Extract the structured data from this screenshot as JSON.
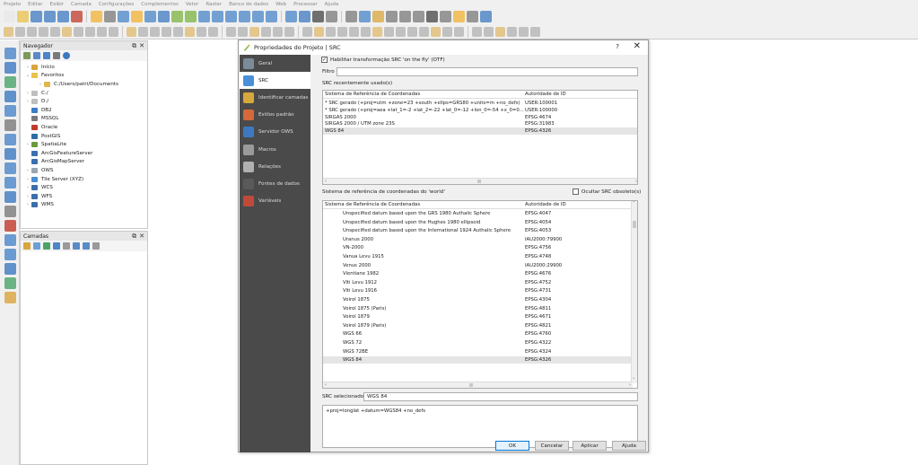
{
  "menubar": [
    "Projeto",
    "Editar",
    "Exibir",
    "Camada",
    "Configurações",
    "Complementos",
    "Vetor",
    "Raster",
    "Banco de dados",
    "Web",
    "Processar",
    "Ajuda"
  ],
  "navigator": {
    "title": "Navegador",
    "items": [
      {
        "label": "Início",
        "arrow": "›",
        "color": "#d9a53c",
        "indent": 0
      },
      {
        "label": "Favoritos",
        "arrow": "⌄",
        "color": "#e9c24a",
        "indent": 0
      },
      {
        "label": "C:/Users/patri/Documents",
        "arrow": "›",
        "color": "#e1b64c",
        "indent": 1
      },
      {
        "label": "C:/",
        "arrow": "›",
        "color": "#bfbfbf",
        "indent": 0
      },
      {
        "label": "D:/",
        "arrow": "›",
        "color": "#bfbfbf",
        "indent": 0
      },
      {
        "label": "DB2",
        "arrow": "",
        "color": "#3d7cc9",
        "indent": 0
      },
      {
        "label": "MSSQL",
        "arrow": "",
        "color": "#7a7a7a",
        "indent": 0
      },
      {
        "label": "Oracle",
        "arrow": "",
        "color": "#c0392b",
        "indent": 0
      },
      {
        "label": "PostGIS",
        "arrow": "",
        "color": "#2e6da4",
        "indent": 0
      },
      {
        "label": "SpatiaLite",
        "arrow": "›",
        "color": "#6b9b3c",
        "indent": 0
      },
      {
        "label": "ArcGisFeatureServer",
        "arrow": "",
        "color": "#3a6fb0",
        "indent": 0
      },
      {
        "label": "ArcGisMapServer",
        "arrow": "",
        "color": "#3a6fb0",
        "indent": 0
      },
      {
        "label": "OWS",
        "arrow": "›",
        "color": "#9aa6b2",
        "indent": 0
      },
      {
        "label": "Tile Server (XYZ)",
        "arrow": "›",
        "color": "#4a8fd3",
        "indent": 0
      },
      {
        "label": "WCS",
        "arrow": "›",
        "color": "#3b6fa8",
        "indent": 0
      },
      {
        "label": "WFS",
        "arrow": "›",
        "color": "#3b6fa8",
        "indent": 0
      },
      {
        "label": "WMS",
        "arrow": "›",
        "color": "#3b6fa8",
        "indent": 0
      }
    ]
  },
  "layers": {
    "title": "Camadas"
  },
  "dialog": {
    "title": "Propriedades do Projeto | SRC",
    "help": "?",
    "close": "✕",
    "sidebar": [
      {
        "label": "Geral",
        "color": "#7c8b9a"
      },
      {
        "label": "SRC",
        "color": "#4a90d9"
      },
      {
        "label": "Identificar camadas",
        "color": "#d6a83c"
      },
      {
        "label": "Estilos padrão",
        "color": "#d4693b"
      },
      {
        "label": "Servidor OWS",
        "color": "#3d79c0"
      },
      {
        "label": "Macros",
        "color": "#9a9a9a"
      },
      {
        "label": "Relações",
        "color": "#b0b0b0"
      },
      {
        "label": "Fontes de dados",
        "color": "#5a5a5a"
      },
      {
        "label": "Variáveis",
        "color": "#c04a3a"
      }
    ],
    "otf_label": "Habilitar transformação SRC 'on the fly' (OTF)",
    "otf_checked": "✓",
    "filter_label": "Filtro",
    "filter_value": "",
    "recent_label": "SRC recentemente usado(s)",
    "col_name": "Sistema de Referência de Coordenadas",
    "col_authority": "Autoridade de ID",
    "recent": [
      {
        "name": "* SRC gerado (+proj=utm +zone=23 +south +ellps=GRS80 +units=m +no_defs)",
        "id": "USER:100001"
      },
      {
        "name": "* SRC gerado (+proj=aea +lat_1=-2 +lat_2=-22 +lat_0=-12 +lon_0=-54 +x_0=0...",
        "id": "USER:100000"
      },
      {
        "name": "SIRGAS 2000",
        "id": "EPSG:4674"
      },
      {
        "name": "SIRGAS 2000 / UTM zone 23S",
        "id": "EPSG:31983"
      },
      {
        "name": "WGS 84",
        "id": "EPSG:4326"
      }
    ],
    "world_label": "Sistema de referência de coordenadas do 'world'",
    "hide_deprecated": "Ocultar SRC obsoleto(s)",
    "world": [
      {
        "name": "Unspecified datum based upon the GRS 1980 Authalic Sphere",
        "id": "EPSG:4047"
      },
      {
        "name": "Unspecified datum based upon the Hughes 1980 ellipsoid",
        "id": "EPSG:4054"
      },
      {
        "name": "Unspecified datum based upon the International 1924 Authalic Sphere",
        "id": "EPSG:4053"
      },
      {
        "name": "Uranus 2000",
        "id": "IAU2000:79900"
      },
      {
        "name": "VN-2000",
        "id": "EPSG:4756"
      },
      {
        "name": "Vanua Levu 1915",
        "id": "EPSG:4748"
      },
      {
        "name": "Venus 2000",
        "id": "IAU2000:29900"
      },
      {
        "name": "Vientiane 1982",
        "id": "EPSG:4676"
      },
      {
        "name": "Viti Levu 1912",
        "id": "EPSG:4752"
      },
      {
        "name": "Viti Levu 1916",
        "id": "EPSG:4731"
      },
      {
        "name": "Voirol 1875",
        "id": "EPSG:4304"
      },
      {
        "name": "Voirol 1875 (Paris)",
        "id": "EPSG:4811"
      },
      {
        "name": "Voirol 1879",
        "id": "EPSG:4671"
      },
      {
        "name": "Voirol 1879 (Paris)",
        "id": "EPSG:4821"
      },
      {
        "name": "WGS 66",
        "id": "EPSG:4760"
      },
      {
        "name": "WGS 72",
        "id": "EPSG:4322"
      },
      {
        "name": "WGS 72BE",
        "id": "EPSG:4324"
      },
      {
        "name": "WGS 84",
        "id": "EPSG:4326"
      }
    ],
    "selected_label": "SRC selecionado:",
    "selected_value": "WGS 84",
    "proj_text": "+proj=longlat +datum=WGS84 +no_defs",
    "buttons": {
      "ok": "OK",
      "cancel": "Cancelar",
      "apply": "Aplicar",
      "help": "Ajuda"
    }
  }
}
